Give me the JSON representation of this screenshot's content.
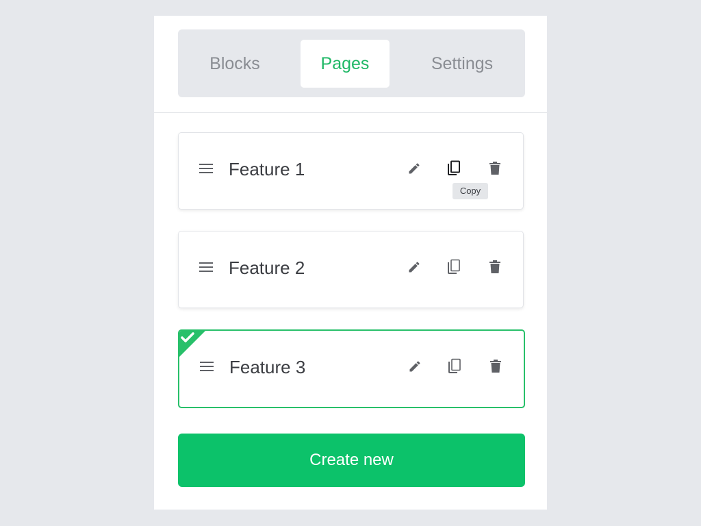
{
  "tabs": [
    {
      "label": "Blocks",
      "active": false
    },
    {
      "label": "Pages",
      "active": true
    },
    {
      "label": "Settings",
      "active": false
    }
  ],
  "pages": [
    {
      "title": "Feature 1",
      "selected": false
    },
    {
      "title": "Feature 2",
      "selected": false
    },
    {
      "title": "Feature 3",
      "selected": true
    }
  ],
  "tooltip": {
    "text": "Copy"
  },
  "create_button": {
    "label": "Create new"
  },
  "colors": {
    "accent": "#0cc26a",
    "tab_active_text": "#1fb866",
    "tab_inactive_text": "#8a8d93",
    "icon": "#5f6166",
    "icon_hover": "#1f2023",
    "background": "#e6e8ec"
  },
  "icons": {
    "drag": "drag-handle-icon",
    "edit": "pencil-icon",
    "copy": "copy-icon",
    "delete": "trash-icon",
    "selected": "checkmark-icon"
  }
}
